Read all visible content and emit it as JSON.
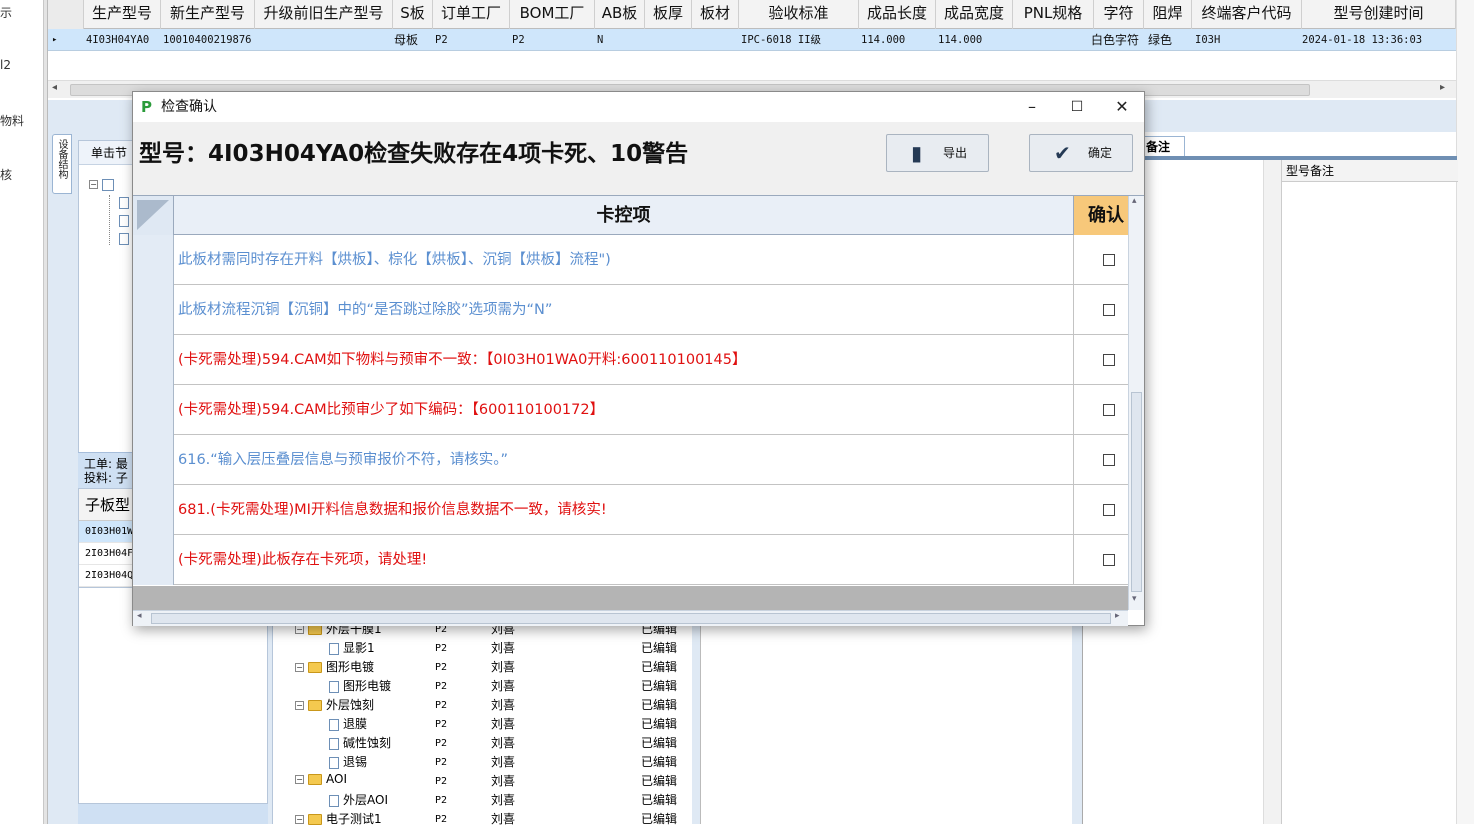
{
  "left_strip": {
    "items": [
      "示",
      "l2",
      "物料",
      "核"
    ]
  },
  "top_grid": {
    "columns": [
      "生产型号",
      "新生产型号",
      "升级前旧生产型号",
      "S板",
      "订单工厂",
      "BOM工厂",
      "AB板",
      "板厚",
      "板材",
      "验收标准",
      "成品长度",
      "成品宽度",
      "PNL规格",
      "字符",
      "阻焊",
      "终端客户代码",
      "型号创建时间"
    ],
    "row": {
      "marker": "▸",
      "cells": [
        "4I03H04YA0",
        "10010400219876",
        "",
        "母板",
        "P2",
        "P2",
        "N",
        "",
        "",
        "IPC-6018 II级",
        "114.000",
        "114.000",
        "",
        "白色字符",
        "绿色",
        "I03H",
        "2024-01-18 13:36:03"
      ]
    }
  },
  "left_panel": {
    "vertical_tab": "设备结构",
    "tab_label": "单击节",
    "info_line1": "工单: 最",
    "info_line2": "投料: 子",
    "subgrid_header": "子板型",
    "subgrid_rows": [
      "0I03H01W",
      "2I03H04F",
      "2I03H04Q"
    ]
  },
  "process_tree": [
    {
      "name": "外层干膜1",
      "type": "folder",
      "factory": "P2",
      "user": "刘喜",
      "status": "已编辑"
    },
    {
      "name": "显影1",
      "type": "file",
      "factory": "P2",
      "user": "刘喜",
      "status": "已编辑"
    },
    {
      "name": "图形电镀",
      "type": "folder",
      "factory": "P2",
      "user": "刘喜",
      "status": "已编辑"
    },
    {
      "name": "图形电镀",
      "type": "file",
      "factory": "P2",
      "user": "刘喜",
      "status": "已编辑"
    },
    {
      "name": "外层蚀刻",
      "type": "folder",
      "factory": "P2",
      "user": "刘喜",
      "status": "已编辑"
    },
    {
      "name": "退膜",
      "type": "file",
      "factory": "P2",
      "user": "刘喜",
      "status": "已编辑"
    },
    {
      "name": "碱性蚀刻",
      "type": "file",
      "factory": "P2",
      "user": "刘喜",
      "status": "已编辑"
    },
    {
      "name": "退锡",
      "type": "file",
      "factory": "P2",
      "user": "刘喜",
      "status": "已编辑"
    },
    {
      "name": "AOI",
      "type": "folder",
      "factory": "P2",
      "user": "刘喜",
      "status": "已编辑"
    },
    {
      "name": "外层AOI",
      "type": "file",
      "factory": "P2",
      "user": "刘喜",
      "status": "已编辑"
    },
    {
      "name": "电子测试1",
      "type": "folder",
      "factory": "P2",
      "user": "刘喜",
      "status": "已编辑"
    }
  ],
  "right_panel": {
    "tab_label": "备注",
    "column_header": "型号备注"
  },
  "dialog": {
    "title": "检查确认",
    "headline": "型号：4I03H04YA0检查失败存在4项卡死、10警告",
    "export_label": "导出",
    "confirm_label": "确定",
    "col_items": "卡控项",
    "col_confirm": "确认",
    "rows": [
      {
        "text": "此板材需同时存在开料【烘板】、棕化【烘板】、沉铜【烘板】流程\")",
        "severity": "warn"
      },
      {
        "text": "此板材流程沉铜【沉铜】中的“是否跳过除胶”选项需为“N”",
        "severity": "warn"
      },
      {
        "text": "(卡死需处理)594.CAM如下物料与预审不一致：【0I03H01WA0开料:600110100145】",
        "severity": "block"
      },
      {
        "text": "(卡死需处理)594.CAM比预审少了如下编码：【600110100172】",
        "severity": "block"
      },
      {
        "text": "616.“输入层压叠层信息与预审报价不符，请核实。”",
        "severity": "warn"
      },
      {
        "text": "681.(卡死需处理)MI开料信息数据和报价信息数据不一致，请核实!",
        "severity": "block"
      },
      {
        "text": "(卡死需处理)此板存在卡死项，请处理!",
        "severity": "block"
      }
    ]
  },
  "colors": {
    "warn": "#5b8fd0",
    "block": "#e01010",
    "selected_row": "#cfe6fb",
    "confirm_header": "#f7c87a"
  }
}
